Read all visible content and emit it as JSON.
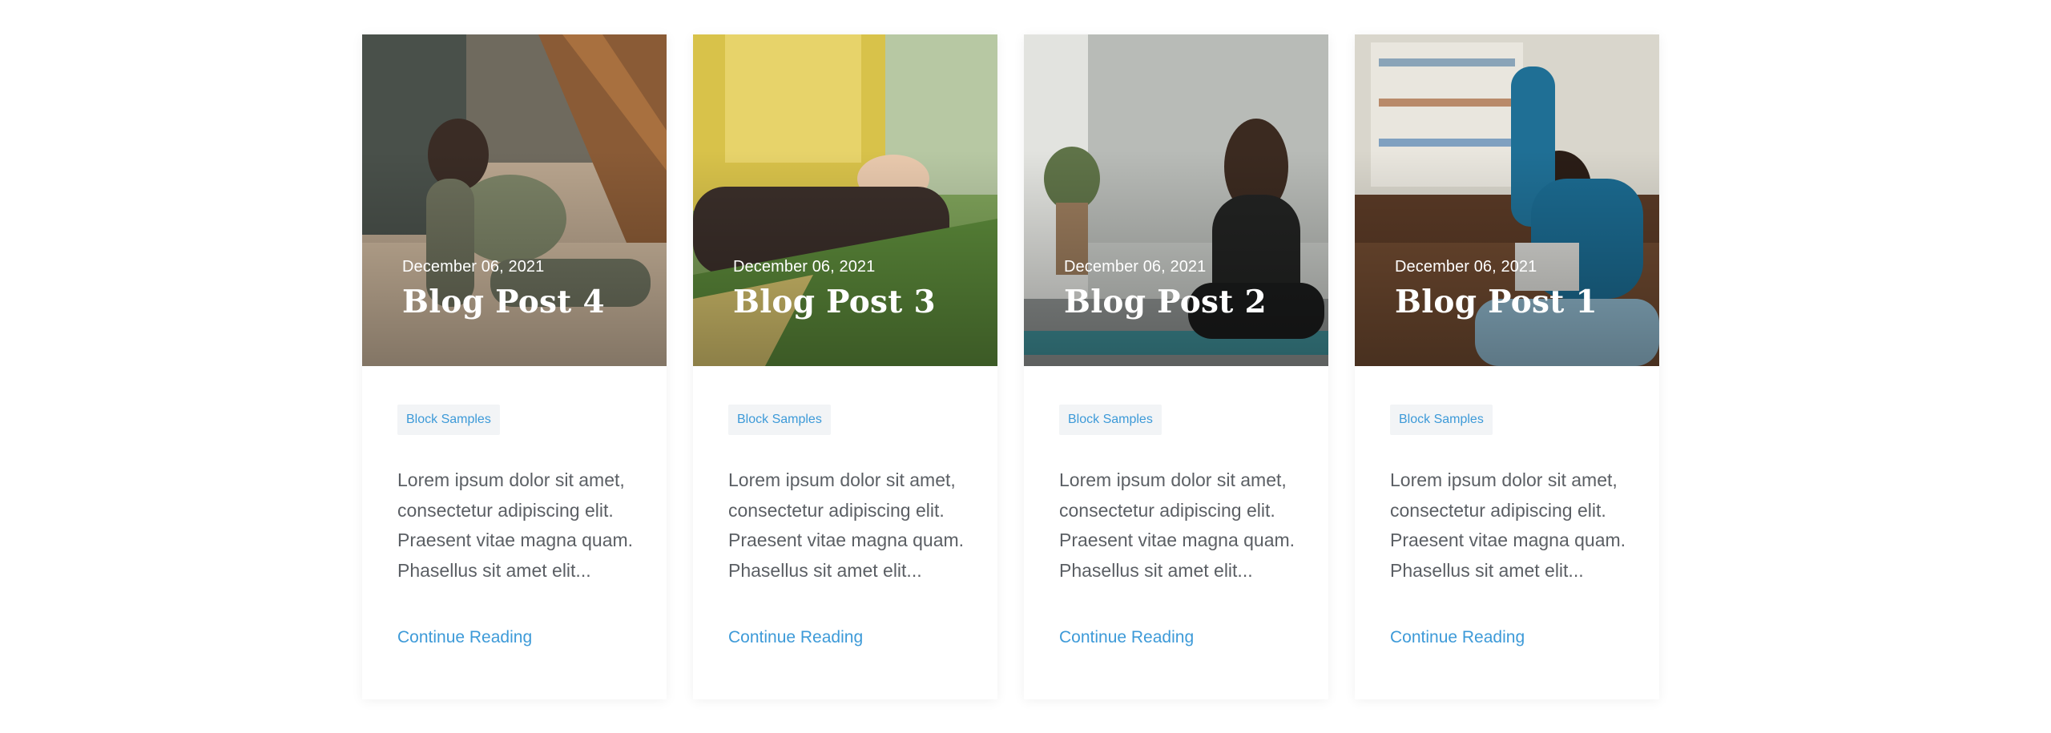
{
  "posts": [
    {
      "date": "December 06, 2021",
      "title": "Blog Post 4",
      "category": "Block Samples",
      "excerpt": "Lorem ipsum dolor sit amet, consectetur adipiscing elit. Praesent vitae magna quam. Phasellus sit amet elit...",
      "link_label": "Continue Reading"
    },
    {
      "date": "December 06, 2021",
      "title": "Blog Post 3",
      "category": "Block Samples",
      "excerpt": "Lorem ipsum dolor sit amet, consectetur adipiscing elit. Praesent vitae magna quam. Phasellus sit amet elit...",
      "link_label": "Continue Reading"
    },
    {
      "date": "December 06, 2021",
      "title": "Blog Post 2",
      "category": "Block Samples",
      "excerpt": "Lorem ipsum dolor sit amet, consectetur adipiscing elit. Praesent vitae magna quam. Phasellus sit amet elit...",
      "link_label": "Continue Reading"
    },
    {
      "date": "December 06, 2021",
      "title": "Blog Post 1",
      "category": "Block Samples",
      "excerpt": "Lorem ipsum dolor sit amet, consectetur adipiscing elit. Praesent vitae magna quam. Phasellus sit amet elit...",
      "link_label": "Continue Reading"
    }
  ],
  "colors": {
    "accent": "#3d9ad8",
    "text": "#5b5f64",
    "tag_bg": "#f2f4f6"
  }
}
